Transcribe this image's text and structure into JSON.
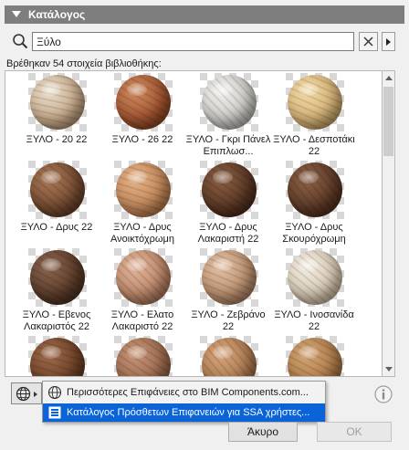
{
  "panel": {
    "title": "Κατάλογος"
  },
  "search": {
    "value": "Ξύλο",
    "icon": "search-icon"
  },
  "results": {
    "count_text": "Βρέθηκαν 54 στοιχεία βιβλιοθήκης:"
  },
  "items": [
    {
      "label": "ΞΥΛΟ - 20 22",
      "colors": [
        "#e9dccb",
        "#c9ad8d",
        "#8e6a4d"
      ]
    },
    {
      "label": "ΞΥΛΟ - 26 22",
      "colors": [
        "#cf8a5e",
        "#a45631",
        "#6a2d13"
      ]
    },
    {
      "label": "ΞΥΛΟ - Γκρι Πάνελ Επιπλωσ...",
      "colors": [
        "#f0efec",
        "#cfcdc8",
        "#8d8b87"
      ]
    },
    {
      "label": "ΞΥΛΟ - Δεσποτάκι 22",
      "colors": [
        "#f1d9a6",
        "#d8b579",
        "#9d7a45"
      ]
    },
    {
      "label": "ΞΥΛΟ - Δρυς 22",
      "colors": [
        "#a97a58",
        "#7a4e33",
        "#4a2a18"
      ]
    },
    {
      "label": "ΞΥΛΟ - Δρυς Ανοικτόχρωμη",
      "colors": [
        "#e3b287",
        "#c68a5c",
        "#8e5a35"
      ]
    },
    {
      "label": "ΞΥΛΟ - Δρυς Λακαριστή 22",
      "colors": [
        "#8a5f45",
        "#5e3a26",
        "#33190c"
      ]
    },
    {
      "label": "ΞΥΛΟ - Δρυς Σκουρόχρωμη",
      "colors": [
        "#8c6248",
        "#613d28",
        "#3a1f10"
      ]
    },
    {
      "label": "ΞΥΛΟ - Εβενος Λακαριστός 22",
      "colors": [
        "#8b6650",
        "#5f3e2c",
        "#361f12"
      ]
    },
    {
      "label": "ΞΥΛΟ - Ελατο Λακαριστό 22",
      "colors": [
        "#e2b59a",
        "#c08a6c",
        "#88593f"
      ]
    },
    {
      "label": "ΞΥΛΟ - Ζεβράνο 22",
      "colors": [
        "#e2c0a3",
        "#bf9372",
        "#875f42"
      ]
    },
    {
      "label": "ΞΥΛΟ - Ινοσανίδα 22",
      "colors": [
        "#f3ece2",
        "#d9cbb6",
        "#a6937a"
      ]
    },
    {
      "label": "",
      "colors": [
        "#9e6a4b",
        "#734429",
        "#4a2614"
      ]
    },
    {
      "label": "",
      "colors": [
        "#c69476",
        "#a06d50",
        "#6d452e"
      ]
    },
    {
      "label": "",
      "colors": [
        "#d6a67c",
        "#b07c52",
        "#7a5232"
      ]
    },
    {
      "label": "",
      "colors": [
        "#d4a574",
        "#b27f4d",
        "#7e5530"
      ]
    }
  ],
  "menu": {
    "items": [
      {
        "label": "Περισσότερες Επιφάνειες στο BIM Components.com...",
        "icon": "globe-icon",
        "selected": false
      },
      {
        "label": "Κατάλογος Πρόσθετων Επιφανειών για SSA χρήστες...",
        "icon": "catalog-icon",
        "selected": true
      }
    ]
  },
  "buttons": {
    "cancel": "Άκυρο",
    "ok": "OK"
  },
  "colors": {
    "header_bg": "#7e7e7e",
    "menu_highlight": "#0a64d8"
  }
}
